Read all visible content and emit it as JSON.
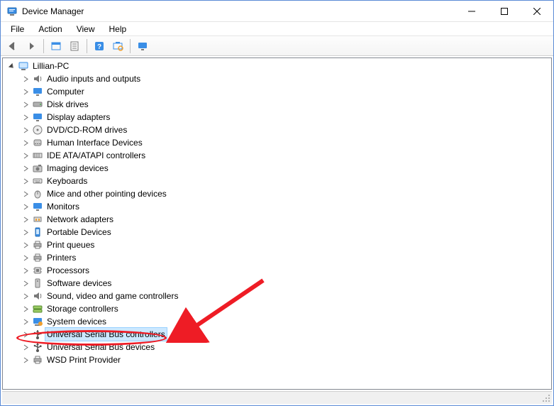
{
  "window": {
    "title": "Device Manager"
  },
  "menu": {
    "items": [
      "File",
      "Action",
      "View",
      "Help"
    ]
  },
  "toolbar": {
    "back": "Back",
    "forward": "Forward",
    "show_hidden": "Show hidden devices",
    "properties": "Properties",
    "help": "Help",
    "scan": "Scan for hardware changes",
    "display": "Display"
  },
  "tree": {
    "root": {
      "label": "Lillian-PC",
      "expanded": true,
      "icon": "computer"
    },
    "items": [
      {
        "label": "Audio inputs and outputs",
        "icon": "speaker"
      },
      {
        "label": "Computer",
        "icon": "monitor"
      },
      {
        "label": "Disk drives",
        "icon": "drive"
      },
      {
        "label": "Display adapters",
        "icon": "monitor"
      },
      {
        "label": "DVD/CD-ROM drives",
        "icon": "disc"
      },
      {
        "label": "Human Interface Devices",
        "icon": "hid"
      },
      {
        "label": "IDE ATA/ATAPI controllers",
        "icon": "ide"
      },
      {
        "label": "Imaging devices",
        "icon": "camera"
      },
      {
        "label": "Keyboards",
        "icon": "keyboard"
      },
      {
        "label": "Mice and other pointing devices",
        "icon": "mouse"
      },
      {
        "label": "Monitors",
        "icon": "monitor"
      },
      {
        "label": "Network adapters",
        "icon": "network"
      },
      {
        "label": "Portable Devices",
        "icon": "portable"
      },
      {
        "label": "Print queues",
        "icon": "printer"
      },
      {
        "label": "Printers",
        "icon": "printer"
      },
      {
        "label": "Processors",
        "icon": "cpu"
      },
      {
        "label": "Software devices",
        "icon": "software"
      },
      {
        "label": "Sound, video and game controllers",
        "icon": "speaker"
      },
      {
        "label": "Storage controllers",
        "icon": "storage"
      },
      {
        "label": "System devices",
        "icon": "system"
      },
      {
        "label": "Universal Serial Bus controllers",
        "icon": "usb",
        "selected": true,
        "highlighted_by_annotation": true
      },
      {
        "label": "Universal Serial Bus devices",
        "icon": "usb"
      },
      {
        "label": "WSD Print Provider",
        "icon": "printer"
      }
    ]
  },
  "annotation": {
    "arrow_color": "#ee1c25",
    "ellipse_color": "#ee1c25",
    "target_item_index": 20
  }
}
